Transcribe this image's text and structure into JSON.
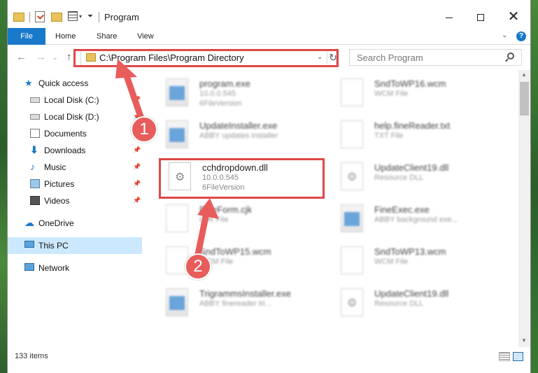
{
  "window": {
    "title": "Program"
  },
  "ribbon": {
    "tabs": [
      {
        "label": "File"
      },
      {
        "label": "Home"
      },
      {
        "label": "Share"
      },
      {
        "label": "View"
      }
    ]
  },
  "navbar": {
    "address": "C:\\Program Files\\Program Directory",
    "search_placeholder": "Search Program"
  },
  "sidebar": {
    "items": [
      {
        "label": "Quick access",
        "icon": "quick-access-star-icon",
        "pinned": false,
        "selected": false
      },
      {
        "label": "Local Disk (C:)",
        "icon": "local-disk-icon",
        "pinned": true,
        "selected": false
      },
      {
        "label": "Local Disk (D:)",
        "icon": "local-disk-icon",
        "pinned": true,
        "selected": false
      },
      {
        "label": "Documents",
        "icon": "documents-icon",
        "pinned": true,
        "selected": false
      },
      {
        "label": "Downloads",
        "icon": "downloads-icon",
        "pinned": true,
        "selected": false
      },
      {
        "label": "Music",
        "icon": "music-icon",
        "pinned": true,
        "selected": false
      },
      {
        "label": "Pictures",
        "icon": "pictures-icon",
        "pinned": true,
        "selected": false
      },
      {
        "label": "Videos",
        "icon": "videos-icon",
        "pinned": true,
        "selected": false
      },
      {
        "label": "OneDrive",
        "icon": "onedrive-cloud-icon",
        "pinned": false,
        "selected": false
      },
      {
        "label": "This PC",
        "icon": "this-pc-icon",
        "pinned": false,
        "selected": true
      },
      {
        "label": "Network",
        "icon": "network-icon",
        "pinned": false,
        "selected": false
      }
    ]
  },
  "files": [
    {
      "name": "program.exe",
      "line2": "10.0.0.545",
      "line3": "6FileVersion",
      "icon": "app",
      "blurred": true
    },
    {
      "name": "SndToWP16.wcm",
      "line2": "WCM File",
      "line3": "",
      "icon": "doc",
      "blurred": true
    },
    {
      "name": "UpdateInstaller.exe",
      "line2": "ABBY updates installer",
      "line3": "",
      "icon": "app",
      "blurred": true
    },
    {
      "name": "help.fineReader.txt",
      "line2": "TXT File",
      "line3": "",
      "icon": "doc",
      "blurred": true
    },
    {
      "name": "cchdropdown.dll",
      "line2": "10.0.0.545",
      "line3": "6FileVersion",
      "icon": "gear",
      "blurred": false
    },
    {
      "name": "UpdateClient19.dll",
      "line2": "Resource DLL",
      "line3": "",
      "icon": "gear",
      "blurred": true
    },
    {
      "name": "FineForm.cjk",
      "line2": "CJK File",
      "line3": "",
      "icon": "doc",
      "blurred": true
    },
    {
      "name": "FineExec.exe",
      "line2": "ABBY background exe...",
      "line3": "",
      "icon": "app",
      "blurred": true
    },
    {
      "name": "SndToWP15.wcm",
      "line2": "WCM File",
      "line3": "",
      "icon": "doc",
      "blurred": true
    },
    {
      "name": "SndToWP13.wcm",
      "line2": "WCM File",
      "line3": "",
      "icon": "doc",
      "blurred": true
    },
    {
      "name": "TrigrammsInstaller.exe",
      "line2": "ABBY finereader tri...",
      "line3": "",
      "icon": "app",
      "blurred": true
    },
    {
      "name": "UpdateClient19.dll",
      "line2": "Resource DLL",
      "line3": "",
      "icon": "gear",
      "blurred": true
    }
  ],
  "statusbar": {
    "count": "133 items"
  },
  "annotations": {
    "badge1": "1",
    "badge2": "2",
    "color": "#e04848"
  }
}
